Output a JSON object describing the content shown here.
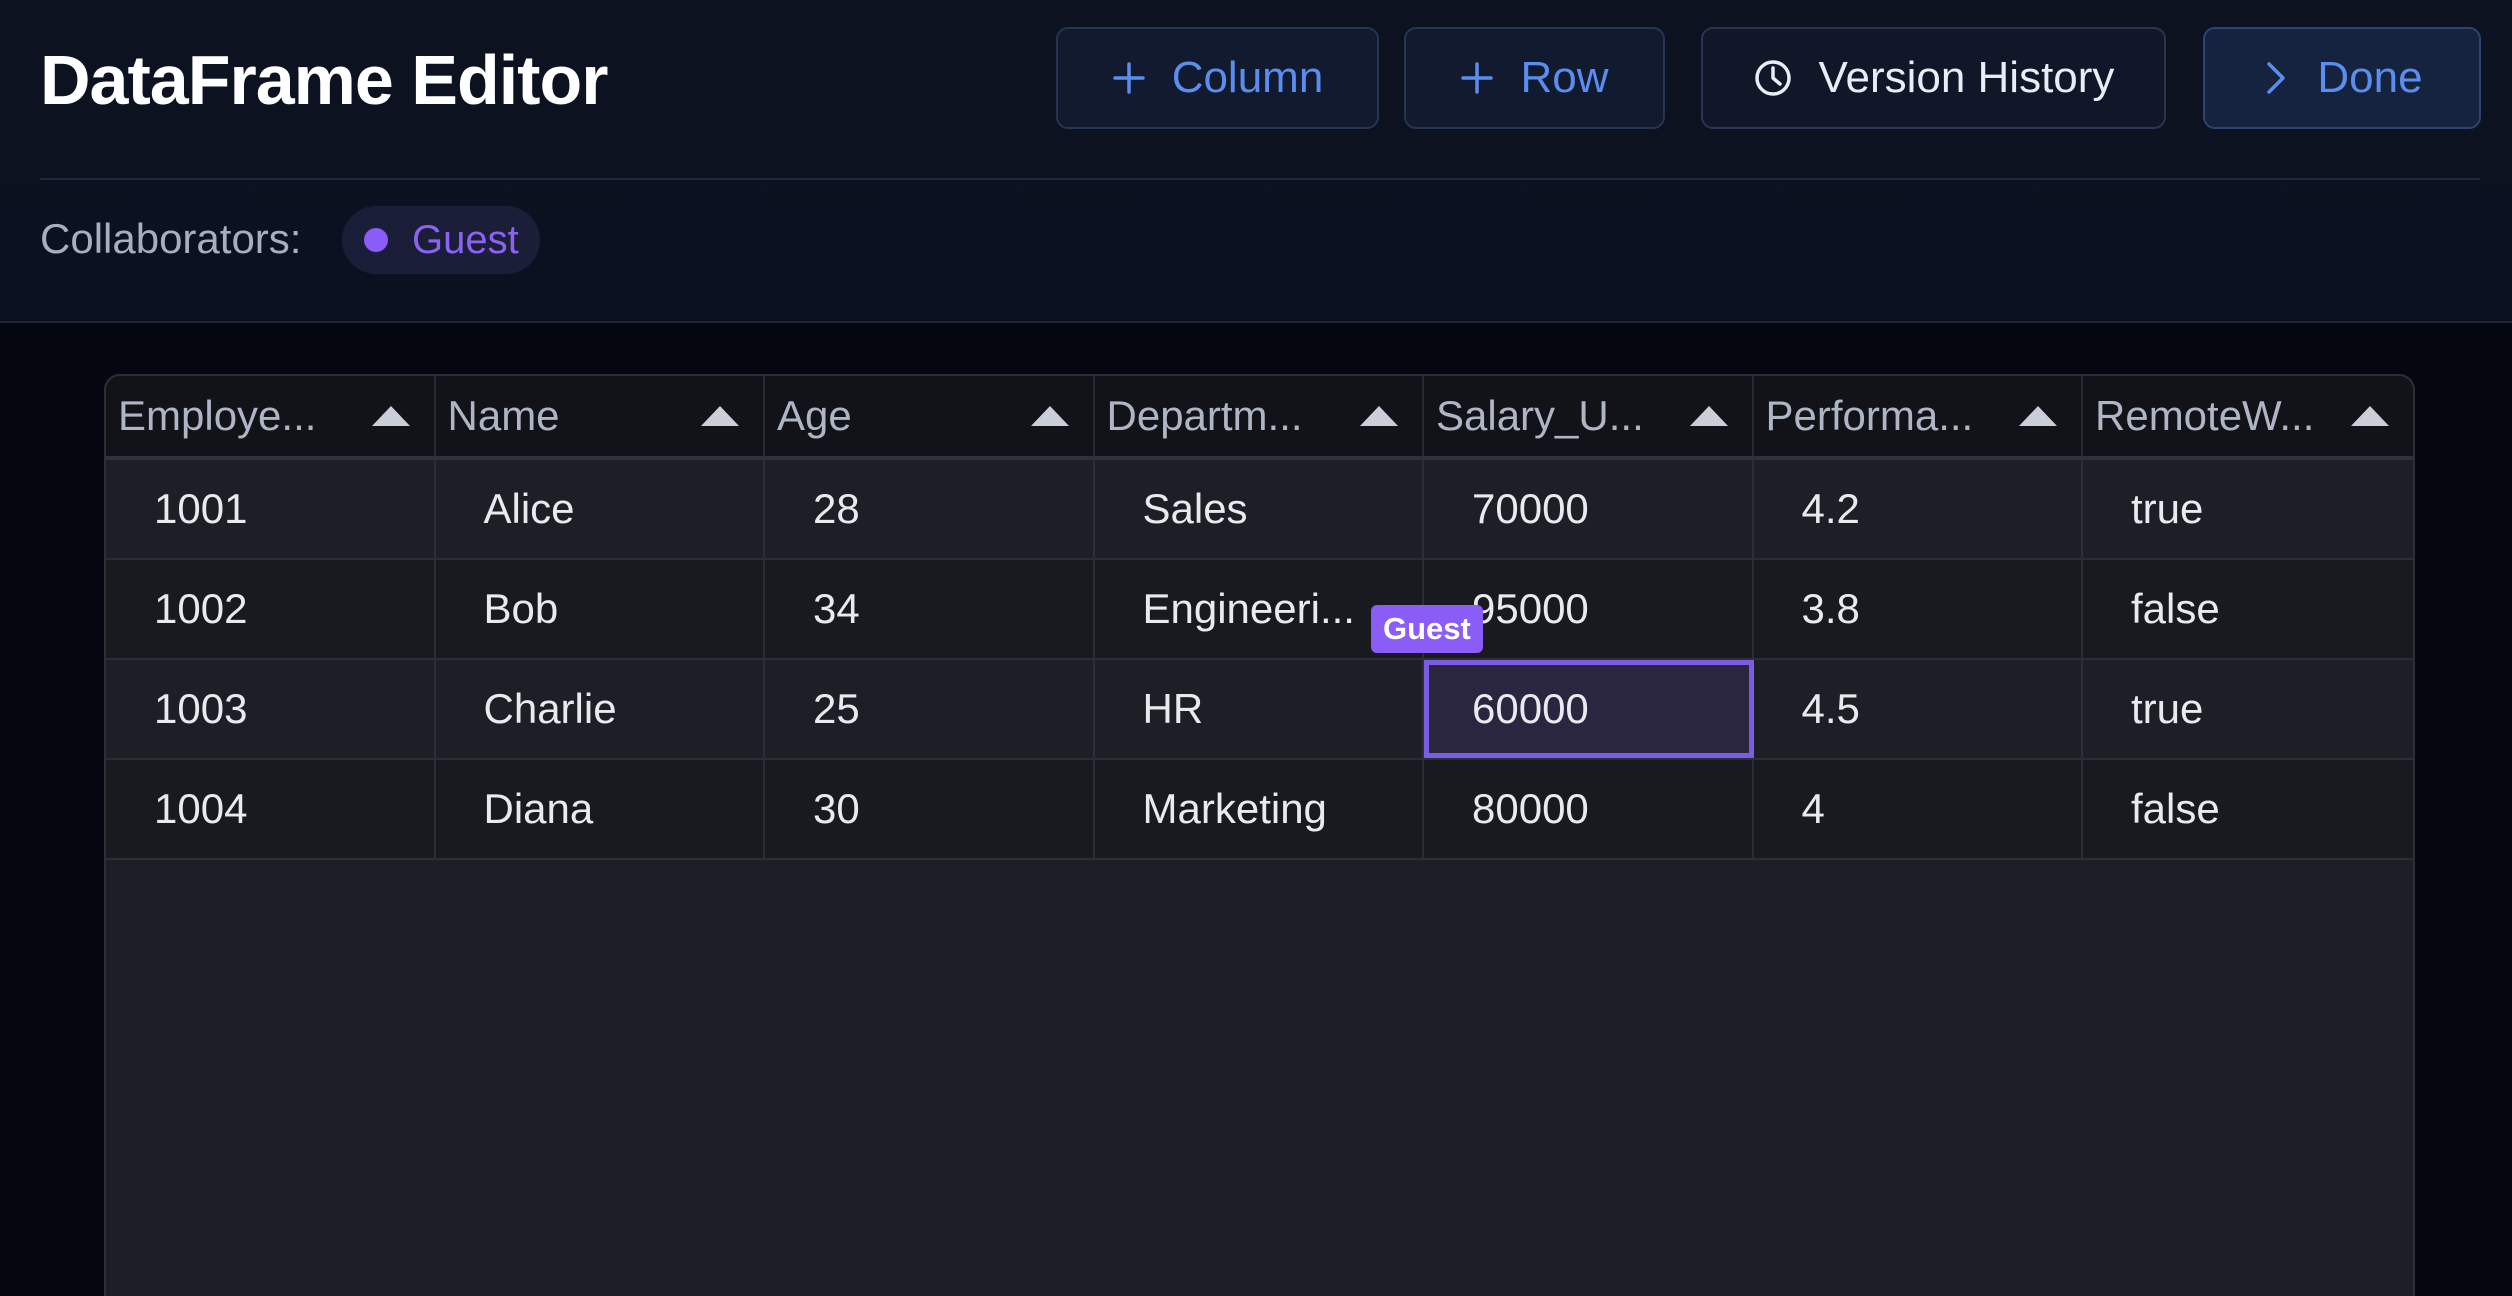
{
  "app": {
    "title": "DataFrame Editor"
  },
  "toolbar": {
    "add_column_label": "Column",
    "add_row_label": "Row",
    "version_history_label": "Version History",
    "done_label": "Done"
  },
  "collaborators": {
    "label": "Collaborators:",
    "users": [
      {
        "name": "Guest",
        "color": "#8b5cf6"
      }
    ]
  },
  "table": {
    "columns": [
      "Employe...",
      "Name",
      "Age",
      "Departm...",
      "Salary_U...",
      "Performa...",
      "RemoteW..."
    ],
    "rows": [
      [
        "1001",
        "Alice",
        "28",
        "Sales",
        "70000",
        "4.2",
        "true"
      ],
      [
        "1002",
        "Bob",
        "34",
        "Engineeri...",
        "95000",
        "3.8",
        "false"
      ],
      [
        "1003",
        "Charlie",
        "25",
        "HR",
        "60000",
        "4.5",
        "true"
      ],
      [
        "1004",
        "Diana",
        "30",
        "Marketing",
        "80000",
        "4",
        "false"
      ]
    ],
    "selected_cell_owner": "Guest"
  },
  "colors": {
    "accent": "#5b8def",
    "collaborator": "#8b5cf6"
  },
  "icons": {
    "add_column": "plus-icon",
    "add_row": "plus-icon",
    "version_history": "clock-icon",
    "done": "chevron-right-icon",
    "sort": "sort-ascending-icon"
  }
}
